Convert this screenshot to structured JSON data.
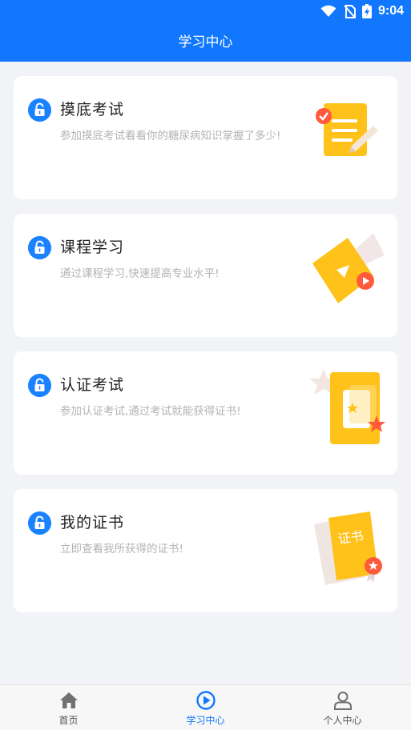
{
  "status_bar": {
    "time": "9:04"
  },
  "header": {
    "title": "学习中心"
  },
  "cards": [
    {
      "title": "摸底考试",
      "desc": "参加摸底考试看看你的糖尿病知识掌握了多少!",
      "icon": "exam-paper-illustration"
    },
    {
      "title": "课程学习",
      "desc": "通过课程学习,快速提高专业水平!",
      "icon": "video-course-illustration"
    },
    {
      "title": "认证考试",
      "desc": "参加认证考试,通过考试就能获得证书!",
      "icon": "certification-card-illustration"
    },
    {
      "title": "我的证书",
      "desc": "立即查看我所获得的证书!",
      "icon": "certificate-illustration",
      "badge_text": "证书"
    }
  ],
  "tabs": [
    {
      "label": "首页",
      "icon": "home-icon"
    },
    {
      "label": "学习中心",
      "icon": "play-circle-icon",
      "active": true
    },
    {
      "label": "个人中心",
      "icon": "user-icon"
    }
  ],
  "colors": {
    "primary": "#1177ff",
    "accent_yellow": "#ffc21a",
    "accent_orange": "#ff6b3d"
  }
}
